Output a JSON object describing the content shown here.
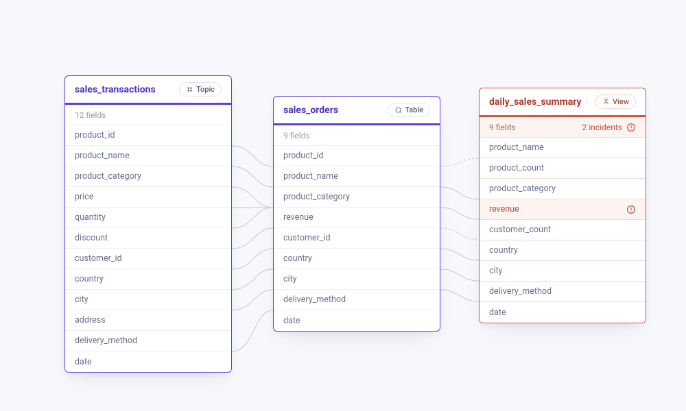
{
  "cards": {
    "transactions": {
      "title": "sales_transactions",
      "badge": "Topic",
      "fields_label": "12 fields",
      "fields": [
        "product_id",
        "product_name",
        "product_category",
        "price",
        "quantity",
        "discount",
        "customer_id",
        "country",
        "city",
        "address",
        "delivery_method",
        "date"
      ]
    },
    "orders": {
      "title": "sales_orders",
      "badge": "Table",
      "fields_label": "9 fields",
      "fields": [
        "product_id",
        "product_name",
        "product_category",
        "revenue",
        "customer_id",
        "country",
        "city",
        "delivery_method",
        "date"
      ]
    },
    "summary": {
      "title": "daily_sales_summary",
      "badge": "View",
      "fields_label": "9 fields",
      "incidents_label": "2 incidents",
      "fields": [
        {
          "name": "product_name"
        },
        {
          "name": "product_count"
        },
        {
          "name": "product_category"
        },
        {
          "name": "revenue",
          "alert": true
        },
        {
          "name": "customer_count"
        },
        {
          "name": "country"
        },
        {
          "name": "city"
        },
        {
          "name": "delivery_method"
        },
        {
          "name": "date"
        }
      ]
    }
  }
}
